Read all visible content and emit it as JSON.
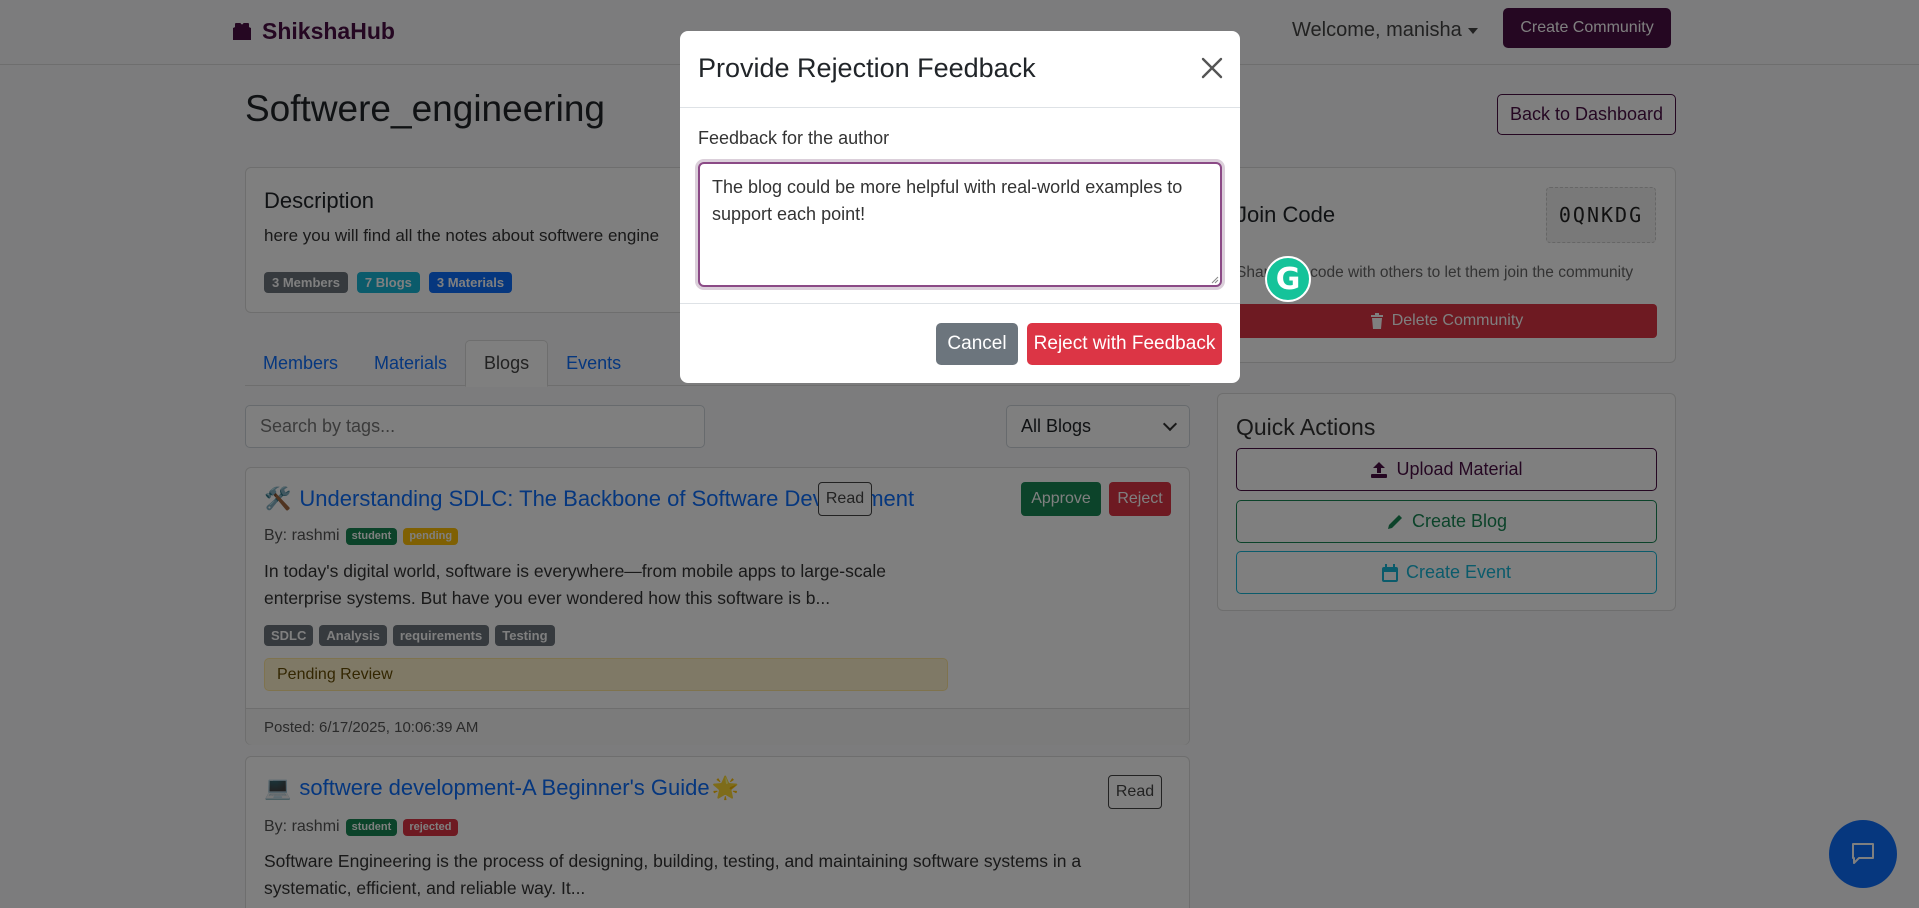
{
  "navbar": {
    "brand": "ShikshaHub",
    "welcome": "Welcome, manisha",
    "create_community": "Create Community"
  },
  "page": {
    "title": "Softwere_engineering",
    "back_button": "Back to Dashboard"
  },
  "description": {
    "title": "Description",
    "text": "here you will find all the notes about softwere engine",
    "badges": [
      "3 Members",
      "7 Blogs",
      "3 Materials"
    ]
  },
  "tabs": [
    "Members",
    "Materials",
    "Blogs",
    "Events"
  ],
  "active_tab": "Blogs",
  "filters": {
    "search_placeholder": "Search by tags...",
    "select_value": "All Blogs"
  },
  "blogs": [
    {
      "emoji": "🛠️",
      "title": "Understanding SDLC: The Backbone of Software Development",
      "by": "By: rashmi",
      "role": "student",
      "status": "pending",
      "excerpt_line1": "In today's digital world, software is everywhere—from mobile apps to large-scale",
      "excerpt_line2": "enterprise systems. But have you ever wondered how this software is b...",
      "tags": [
        "SDLC",
        "Analysis",
        "requirements",
        "Testing"
      ],
      "pending_label": "Pending Review",
      "posted": "Posted: 6/17/2025, 10:06:39 AM",
      "read": "Read",
      "approve": "Approve",
      "reject": "Reject"
    },
    {
      "emoji": "💻",
      "title": "softwere development-A Beginner's Guide",
      "title_suffix_emoji": "🌟",
      "by": "By: rashmi",
      "role": "student",
      "status": "rejected",
      "excerpt_line1": "Software Engineering is the process of designing, building, testing, and maintaining software systems in a",
      "excerpt_line2": "systematic, efficient, and reliable way. It...",
      "read": "Read"
    }
  ],
  "join": {
    "title": "Join Code",
    "code": "0QNKDG",
    "help": "Share this code with others to let them join the community",
    "delete": "Delete Community"
  },
  "quick_actions": {
    "title": "Quick Actions",
    "upload": "Upload Material",
    "create_blog": "Create Blog",
    "create_event": "Create Event"
  },
  "modal": {
    "title": "Provide Rejection Feedback",
    "label": "Feedback for the author",
    "feedback_value": "The blog could be more helpful with real-world examples to support each point!",
    "cancel": "Cancel",
    "submit": "Reject with Feedback"
  },
  "grammarly_letter": "G",
  "colors": {
    "brand": "#4a0f45",
    "primary": "#0d6efd",
    "success": "#198754",
    "danger": "#dc3545",
    "info": "#17b6d6",
    "secondary": "#6c757d",
    "warning": "#ffc107"
  }
}
